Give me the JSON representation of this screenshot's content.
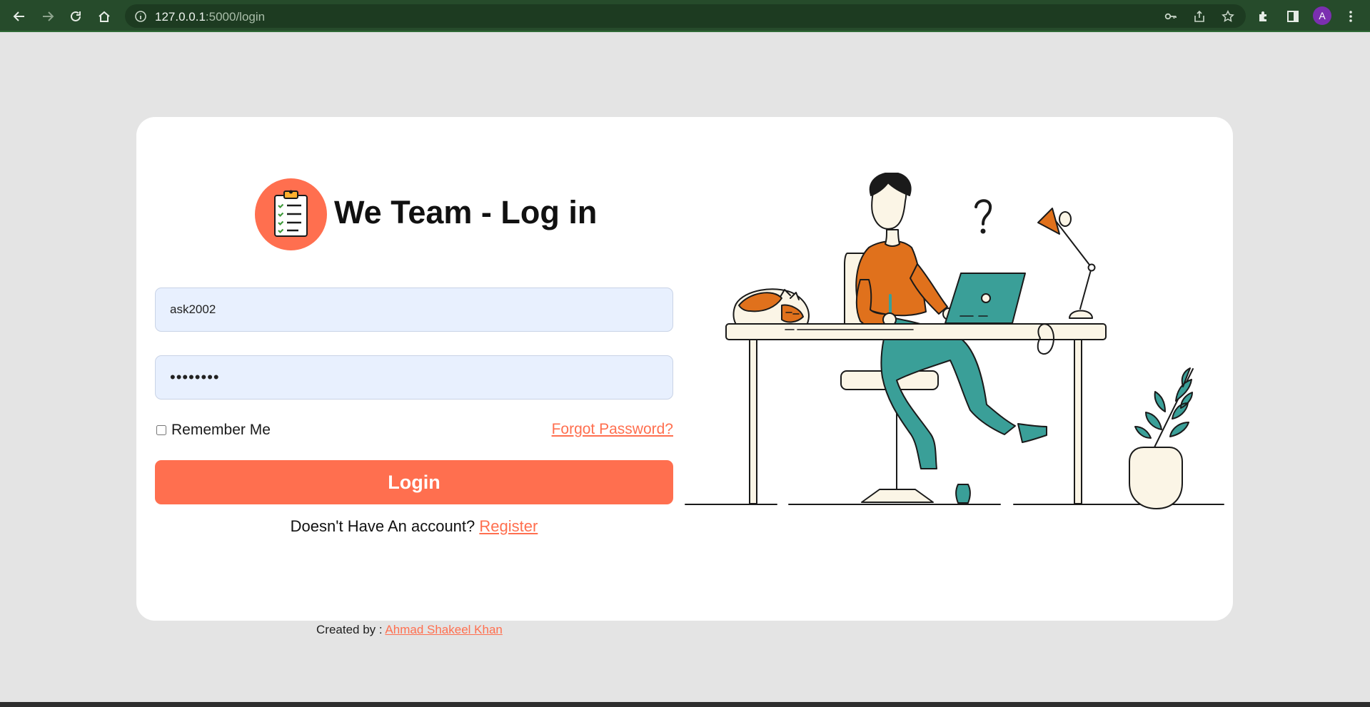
{
  "browser": {
    "url_host": "127.0.0.1",
    "url_path": ":5000/login",
    "profile_initial": "A"
  },
  "app": {
    "title": "We Team - Log in"
  },
  "login_form": {
    "username_value": "ask2002",
    "password_value": "********",
    "remember_label": "Remember Me",
    "remember_checked": false,
    "forgot_label": "Forgot Password?",
    "login_label": "Login",
    "register_prompt": "Doesn't Have An account?",
    "register_label": "Register"
  },
  "footer": {
    "prefix": "Created by :",
    "author": "Ahmad Shakeel Khan"
  },
  "colors": {
    "accent": "#ff6f4f",
    "chrome": "#264b2b",
    "teal": "#3a9f98",
    "orange": "#e0711c"
  },
  "icons": [
    "back-icon",
    "forward-icon",
    "reload-icon",
    "home-icon",
    "info-icon",
    "key-icon",
    "share-icon",
    "star-icon",
    "extensions-icon",
    "side-panel-icon",
    "menu-icon",
    "clipboard-icon"
  ]
}
